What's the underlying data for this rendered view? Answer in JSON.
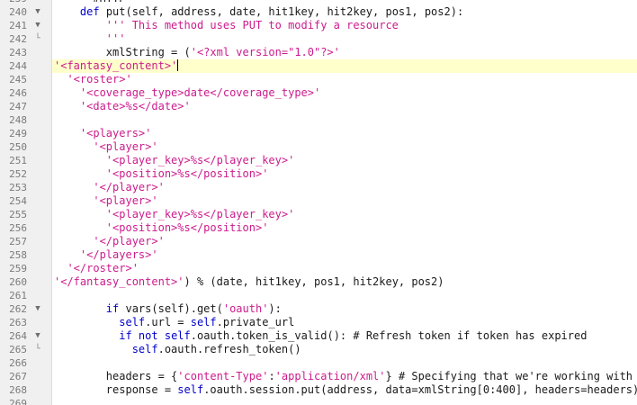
{
  "editor": {
    "lines": [
      {
        "n": "239",
        "fold": "",
        "tokens": [
          {
            "t": "      #HTTP",
            "c": "com"
          }
        ]
      },
      {
        "n": "240",
        "fold": "open",
        "tokens": [
          {
            "t": "    ",
            "c": ""
          },
          {
            "t": "def",
            "c": "kw"
          },
          {
            "t": " put(self, address, date, hit1key, hit2key, pos1, pos2):",
            "c": ""
          }
        ]
      },
      {
        "n": "241",
        "fold": "open",
        "tokens": [
          {
            "t": "        ",
            "c": ""
          },
          {
            "t": "''' This method uses PUT to modify a resource",
            "c": "str"
          }
        ]
      },
      {
        "n": "242",
        "fold": "end",
        "tokens": [
          {
            "t": "        ",
            "c": ""
          },
          {
            "t": "'''",
            "c": "str"
          }
        ]
      },
      {
        "n": "243",
        "fold": "",
        "tokens": [
          {
            "t": "        xmlString = (",
            "c": ""
          },
          {
            "t": "'<?xml version=\"1.0\"?>'",
            "c": "str"
          }
        ]
      },
      {
        "n": "244",
        "fold": "",
        "current": true,
        "tokens": [
          {
            "t": "'<fantasy_content>'",
            "c": "str"
          },
          {
            "t": "|",
            "c": "caret"
          }
        ]
      },
      {
        "n": "245",
        "fold": "",
        "tokens": [
          {
            "t": "  ",
            "c": ""
          },
          {
            "t": "'<roster>'",
            "c": "str"
          }
        ]
      },
      {
        "n": "246",
        "fold": "",
        "tokens": [
          {
            "t": "    ",
            "c": ""
          },
          {
            "t": "'<coverage_type>date</coverage_type>'",
            "c": "str"
          }
        ]
      },
      {
        "n": "247",
        "fold": "",
        "tokens": [
          {
            "t": "    ",
            "c": ""
          },
          {
            "t": "'<date>%s</date>'",
            "c": "str"
          }
        ]
      },
      {
        "n": "248",
        "fold": "",
        "tokens": []
      },
      {
        "n": "249",
        "fold": "",
        "tokens": [
          {
            "t": "    ",
            "c": ""
          },
          {
            "t": "'<players>'",
            "c": "str"
          }
        ]
      },
      {
        "n": "250",
        "fold": "",
        "tokens": [
          {
            "t": "      ",
            "c": ""
          },
          {
            "t": "'<player>'",
            "c": "str"
          }
        ]
      },
      {
        "n": "251",
        "fold": "",
        "tokens": [
          {
            "t": "        ",
            "c": ""
          },
          {
            "t": "'<player_key>%s</player_key>'",
            "c": "str"
          }
        ]
      },
      {
        "n": "252",
        "fold": "",
        "tokens": [
          {
            "t": "        ",
            "c": ""
          },
          {
            "t": "'<position>%s</position>'",
            "c": "str"
          }
        ]
      },
      {
        "n": "253",
        "fold": "",
        "tokens": [
          {
            "t": "      ",
            "c": ""
          },
          {
            "t": "'</player>'",
            "c": "str"
          }
        ]
      },
      {
        "n": "254",
        "fold": "",
        "tokens": [
          {
            "t": "      ",
            "c": ""
          },
          {
            "t": "'<player>'",
            "c": "str"
          }
        ]
      },
      {
        "n": "255",
        "fold": "",
        "tokens": [
          {
            "t": "        ",
            "c": ""
          },
          {
            "t": "'<player_key>%s</player_key>'",
            "c": "str"
          }
        ]
      },
      {
        "n": "256",
        "fold": "",
        "tokens": [
          {
            "t": "        ",
            "c": ""
          },
          {
            "t": "'<position>%s</position>'",
            "c": "str"
          }
        ]
      },
      {
        "n": "257",
        "fold": "",
        "tokens": [
          {
            "t": "      ",
            "c": ""
          },
          {
            "t": "'</player>'",
            "c": "str"
          }
        ]
      },
      {
        "n": "258",
        "fold": "",
        "tokens": [
          {
            "t": "    ",
            "c": ""
          },
          {
            "t": "'</players>'",
            "c": "str"
          }
        ]
      },
      {
        "n": "259",
        "fold": "",
        "tokens": [
          {
            "t": "  ",
            "c": ""
          },
          {
            "t": "'</roster>'",
            "c": "str"
          }
        ]
      },
      {
        "n": "260",
        "fold": "",
        "tokens": [
          {
            "t": "'</fantasy_content>'",
            "c": "str"
          },
          {
            "t": ") % (date, hit1key, pos1, hit2key, pos2)",
            "c": ""
          }
        ]
      },
      {
        "n": "261",
        "fold": "",
        "tokens": []
      },
      {
        "n": "262",
        "fold": "open",
        "tokens": [
          {
            "t": "        ",
            "c": ""
          },
          {
            "t": "if",
            "c": "kw"
          },
          {
            "t": " vars(self).get(",
            "c": ""
          },
          {
            "t": "'oauth'",
            "c": "str"
          },
          {
            "t": "):",
            "c": ""
          }
        ]
      },
      {
        "n": "263",
        "fold": "",
        "tokens": [
          {
            "t": "          ",
            "c": ""
          },
          {
            "t": "self",
            "c": "self"
          },
          {
            "t": ".url = ",
            "c": ""
          },
          {
            "t": "self",
            "c": "self"
          },
          {
            "t": ".private_url",
            "c": ""
          }
        ]
      },
      {
        "n": "264",
        "fold": "open",
        "tokens": [
          {
            "t": "          ",
            "c": ""
          },
          {
            "t": "if not",
            "c": "kw"
          },
          {
            "t": " ",
            "c": ""
          },
          {
            "t": "self",
            "c": "self"
          },
          {
            "t": ".oauth.token_is_valid(): # Refresh token if token has expired",
            "c": ""
          }
        ]
      },
      {
        "n": "265",
        "fold": "end",
        "tokens": [
          {
            "t": "            ",
            "c": ""
          },
          {
            "t": "self",
            "c": "self"
          },
          {
            "t": ".oauth.refresh_token()",
            "c": ""
          }
        ]
      },
      {
        "n": "266",
        "fold": "",
        "tokens": []
      },
      {
        "n": "267",
        "fold": "",
        "tokens": [
          {
            "t": "        headers = {",
            "c": ""
          },
          {
            "t": "'content-Type'",
            "c": "str"
          },
          {
            "t": ":",
            "c": ""
          },
          {
            "t": "'application/xml'",
            "c": "str"
          },
          {
            "t": "} # Specifying that we're working with xml",
            "c": ""
          }
        ]
      },
      {
        "n": "268",
        "fold": "",
        "tokens": [
          {
            "t": "        response = ",
            "c": ""
          },
          {
            "t": "self",
            "c": "self"
          },
          {
            "t": ".oauth.session.put(address, data=xmlString[0:400], headers=headers)",
            "c": ""
          }
        ]
      },
      {
        "n": "269",
        "fold": "",
        "tokens": []
      }
    ]
  }
}
